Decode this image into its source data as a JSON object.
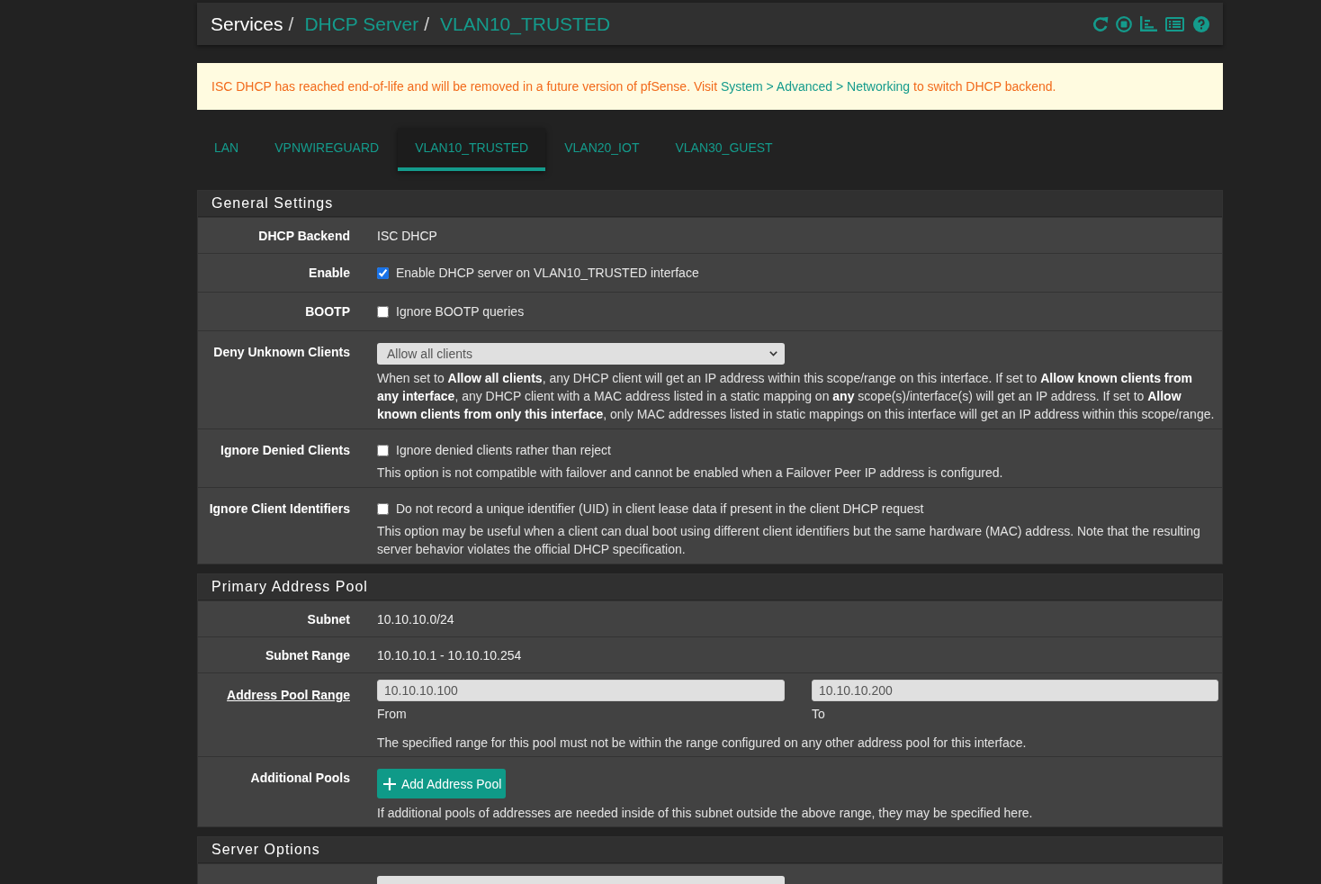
{
  "breadcrumb": [
    {
      "label": "Services",
      "separator": "/",
      "link": false
    },
    {
      "label": "DHCP Server",
      "separator": "/",
      "link": true
    },
    {
      "label": "VLAN10_TRUSTED",
      "link": true
    }
  ],
  "notice": {
    "text": "ISC DHCP has reached end-of-life and will be removed in a future version of pfSense. Visit",
    "link": "System > Advanced > Networking",
    "text_after": "to switch DHCP backend."
  },
  "tabs": [
    {
      "label": "LAN",
      "selected": false
    },
    {
      "label": "VPNWIREGUARD",
      "selected": false
    },
    {
      "label": "VLAN10_TRUSTED",
      "selected": true
    },
    {
      "label": "VLAN20_IOT",
      "selected": false
    },
    {
      "label": "VLAN30_GUEST",
      "selected": false
    }
  ],
  "sections": [
    {
      "title": "General Settings",
      "rows": [
        {
          "kind": "text",
          "label": "DHCP Backend",
          "label_link": false,
          "value": "ISC DHCP"
        },
        {
          "kind": "checkbox",
          "label": "Enable",
          "label_link": false,
          "checked": true,
          "text": "Enable DHCP server on VLAN10_TRUSTED interface"
        },
        {
          "kind": "checkbox",
          "label": "BOOTP",
          "label_link": false,
          "checked": false,
          "text": "Ignore BOOTP queries"
        },
        {
          "kind": "select",
          "label": "Deny Unknown Clients",
          "label_link": false,
          "value": "Allow all clients",
          "help": "When set to **Allow all clients**, any DHCP client will get an IP address within this scope/range on this interface. If set to **Allow known clients from any interface**, any DHCP client with a MAC address listed in a static mapping on **any** scope(s)/interface(s) will get an IP address. If set to **Allow known clients from only this interface**, only MAC addresses listed in static mappings on this interface will get an IP address within this scope/range."
        },
        {
          "kind": "checkbox",
          "label": "Ignore Denied Clients",
          "label_link": false,
          "checked": false,
          "text": "Ignore denied clients rather than reject",
          "help": "This option is not compatible with failover and cannot be enabled when a Failover Peer IP address is configured."
        },
        {
          "kind": "checkbox",
          "label": "Ignore Client Identifiers",
          "label_link": false,
          "checked": false,
          "text": "Do not record a unique identifier (UID) in client lease data if present in the client DHCP request",
          "help": "This option may be useful when a client can dual boot using different client identifiers but the same hardware (MAC) address. Note that the resulting server behavior violates the official DHCP specification."
        }
      ]
    },
    {
      "title": "Primary Address Pool",
      "rows": [
        {
          "kind": "text",
          "label": "Subnet",
          "label_link": false,
          "value": "10.10.10.0/24"
        },
        {
          "kind": "text",
          "label": "Subnet Range",
          "label_link": false,
          "value": "10.10.10.1 - 10.10.10.254"
        },
        {
          "kind": "range",
          "label": "Address Pool Range",
          "label_link": true,
          "from": {
            "value": "10.10.10.100",
            "caption": "From"
          },
          "to": {
            "value": "10.10.10.200",
            "caption": "To"
          },
          "help": "The specified range for this pool must not be within the range configured on any other address pool for this interface."
        },
        {
          "kind": "button",
          "label": "Additional Pools",
          "label_link": false,
          "button": "Add Address Pool",
          "help": "If additional pools of addresses are needed inside of this subnet outside the above range, they may be specified here."
        }
      ]
    },
    {
      "title": "Server Options",
      "rows": [
        {
          "kind": "select"
        }
      ]
    }
  ]
}
